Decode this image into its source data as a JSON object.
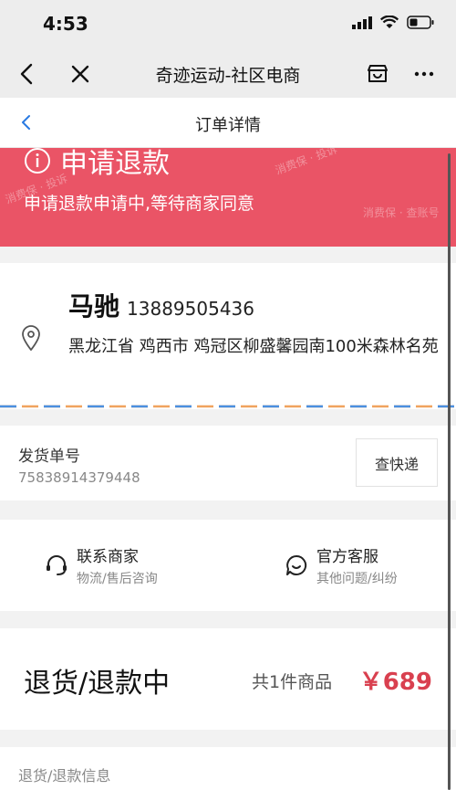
{
  "status_bar": {
    "time": "4:53"
  },
  "wechat_bar": {
    "title": "奇迹运动-社区电商"
  },
  "page_header": {
    "title": "订单详情"
  },
  "refund_banner": {
    "heading": "申请退款",
    "status_text": "申请退款申请中,等待商家同意",
    "color": "#ea5466",
    "watermarks": [
      "消费保 · 投诉",
      "消费保 · 查账号",
      "消费保 · 投诉"
    ]
  },
  "address": {
    "name": "马驰",
    "phone": "13889505436",
    "detail": "黑龙江省 鸡西市 鸡冠区柳盛馨园南100米森林名苑"
  },
  "shipping": {
    "label": "发货单号",
    "number": "75838914379448",
    "track_button": "查快递"
  },
  "services": {
    "merchant": {
      "title": "联系商家",
      "subtitle": "物流/售后咨询"
    },
    "official": {
      "title": "官方客服",
      "subtitle": "其他问题/纠纷"
    }
  },
  "order": {
    "status": "退货/退款中",
    "count": "共1件商品",
    "price": "￥689",
    "price_color": "#d9404f"
  },
  "refund_info": {
    "label": "退货/退款信息"
  },
  "icons": [
    "back-arrow-icon",
    "close-icon",
    "store-icon",
    "more-icon",
    "info-icon",
    "location-pin-icon",
    "headset-icon",
    "chat-bubble-icon"
  ]
}
